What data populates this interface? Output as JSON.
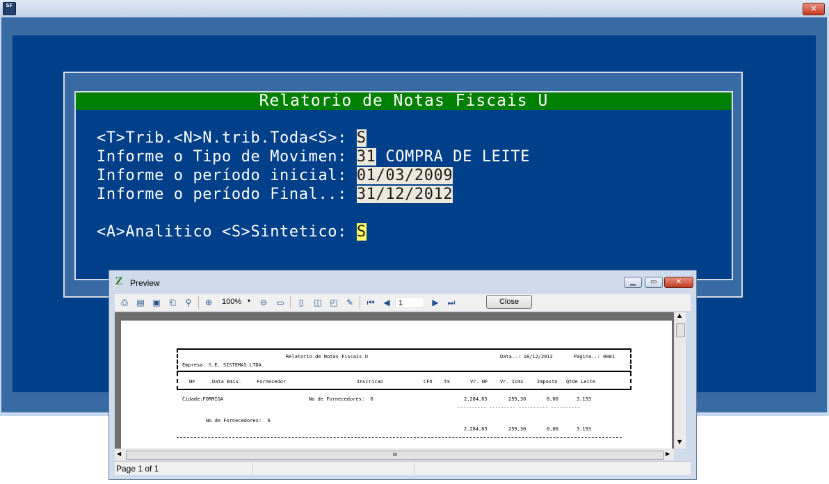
{
  "main": {
    "app_icon_text": "SF",
    "close_glyph": "✕",
    "report_title": "Relatorio de Notas Fiscais U",
    "fields": [
      {
        "label": "<T>Trib.<N>N.trib.Toda<S>: ",
        "value": "S",
        "extra": ""
      },
      {
        "label": "Informe o Tipo de Movimen: ",
        "value": "31",
        "extra": " COMPRA DE LEITE"
      },
      {
        "label": "Informe o período inicial: ",
        "value": "01/03/2009",
        "extra": ""
      },
      {
        "label": "Informe o período Final..: ",
        "value": "31/12/2012",
        "extra": ""
      },
      {
        "label": "<A>Analitico <S>Sintetico: ",
        "value": "S",
        "extra": ""
      }
    ],
    "colors": {
      "background": "#003f89",
      "frame": "#386aa3",
      "title_bar": "#008000",
      "input_bg": "#ece8dc",
      "active_input_bg": "#ffff5e"
    }
  },
  "preview": {
    "window_title": "Preview",
    "min_glyph": "▁",
    "max_glyph": "▭",
    "close_glyph": "✕",
    "toolbar": {
      "icons": [
        "print-icon",
        "open-icon",
        "save-icon",
        "export-icon",
        "find-icon",
        "zoom-in-icon",
        "zoom-out-icon",
        "page-width-icon",
        "one-page-icon",
        "two-pages-icon",
        "book-icon",
        "edit-icon",
        "first-page-icon",
        "prev-page-icon",
        "next-page-icon",
        "last-page-icon"
      ],
      "zoom": "100%",
      "zoom_arrow": "▾",
      "page_number": "1",
      "close_label": "Close"
    },
    "status": "Page 1 of 1",
    "hscroll_thumb": "III",
    "report": {
      "title": "Relatorio de Notas Fiscais U",
      "date_label": "Data..: 18/12/2012",
      "page_label": "Pagina..: 0001",
      "company": "Empresa: S.E. SISTEMAS LTDA",
      "columns": [
        "NF",
        "Data Emis.",
        "Fornecedor",
        "Inscricao",
        "CFO",
        "Tm",
        "Vr. NF",
        "Vr. Icms",
        "Imposto",
        "Qtde Leite"
      ],
      "city_line": {
        "city": "Cidade:FORMIGA",
        "suppliers": "No de Fornecedores:  6",
        "vr_nf": "2.284,65",
        "vr_icms": "259,30",
        "imposto": "0,00",
        "qtde": "3.193"
      },
      "subtotal_dashes": "---------- --------- ---------- ----------",
      "total_label": "No de Fornecedores:  6",
      "total_line": {
        "vr_nf": "2.284,65",
        "vr_icms": "259,30",
        "imposto": "0,00",
        "qtde": "3.193"
      }
    }
  }
}
